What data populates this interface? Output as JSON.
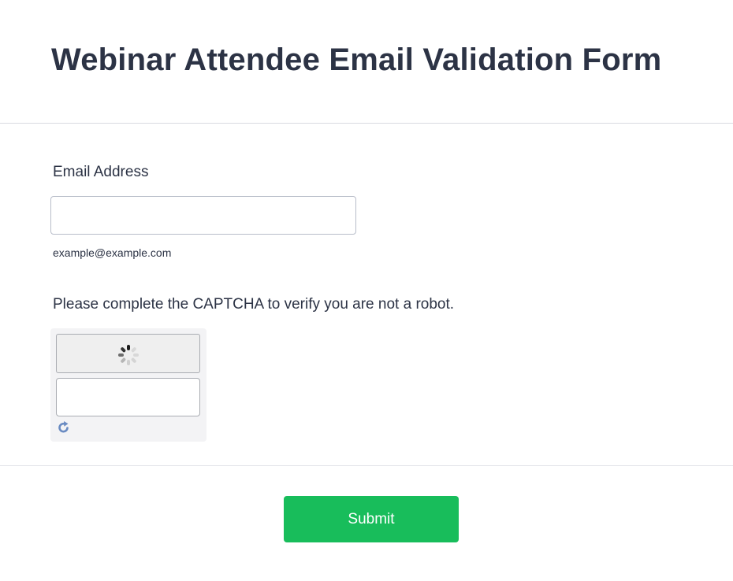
{
  "form": {
    "title": "Webinar Attendee Email Validation Form"
  },
  "email": {
    "label": "Email Address",
    "value": "",
    "placeholder": "",
    "sublabel": "example@example.com"
  },
  "captcha": {
    "label": "Please complete the CAPTCHA to verify you are not a robot.",
    "input_value": "",
    "loading_icon": "spinner-icon",
    "refresh_icon": "refresh-icon"
  },
  "actions": {
    "submit_label": "Submit"
  },
  "colors": {
    "accent": "#18bd5b",
    "text": "#2c3345",
    "border": "#b8bdc9"
  }
}
